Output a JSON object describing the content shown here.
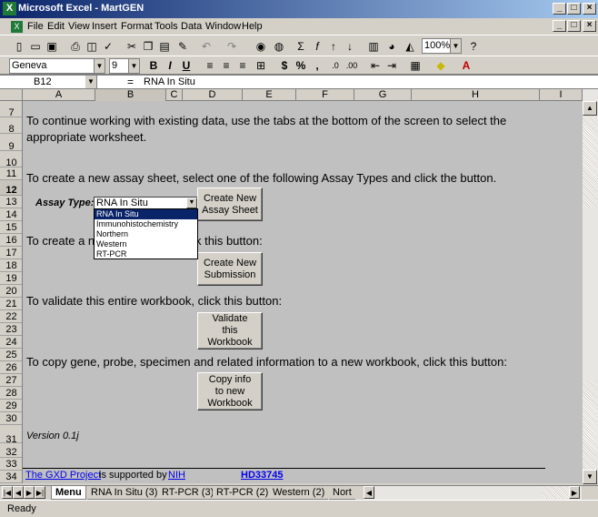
{
  "window": {
    "title": "Microsoft Excel - MartGEN"
  },
  "menu": [
    "File",
    "Edit",
    "View",
    "Insert",
    "Format",
    "Tools",
    "Data",
    "Window",
    "Help"
  ],
  "toolbar": {
    "zoom": "100%",
    "font": "Geneva",
    "size": "9"
  },
  "formula": {
    "cell": "B12",
    "equals": "=",
    "content": "RNA In Situ"
  },
  "columns": [
    "A",
    "B",
    "C",
    "D",
    "E",
    "F",
    "G",
    "H",
    "I"
  ],
  "rows": [
    "7",
    "8",
    "9",
    "10",
    "11",
    "12",
    "13",
    "14",
    "15",
    "16",
    "17",
    "18",
    "19",
    "20",
    "21",
    "22",
    "23",
    "24",
    "25",
    "26",
    "27",
    "28",
    "29",
    "30",
    "31",
    "32",
    "33",
    "34"
  ],
  "text": {
    "continue": "To continue working with existing data, use the tabs at the bottom of the screen to select the",
    "continue2": "appropriate worksheet.",
    "create": "To create a new assay sheet, select one of the following Assay Types and click the button.",
    "assay_label": "Assay Type:",
    "create_sub": "To create a n",
    "create_sub2": "k this button:",
    "validate": "To validate this entire workbook, click this button:",
    "copy": "To copy gene, probe, specimen and related  information to a new workbook, click this button:",
    "version": "Version 0.1j",
    "gxd": "The GXD Project",
    "supported": "is supported by",
    "nih": "NIH",
    "grant": "HD33745"
  },
  "buttons": {
    "new_assay": "Create New Assay Sheet",
    "new_sub": "Create New Submission",
    "validate": "Validate this Workbook",
    "copy": "Copy info to new Workbook"
  },
  "assay_select": {
    "value": "RNA In Situ",
    "options": [
      "RNA In Situ",
      "Immunohistochemistry",
      "Northern",
      "Western",
      "RT-PCR"
    ]
  },
  "tabs": [
    "Menu",
    "RNA In Situ (3)",
    "RT-PCR (3)",
    "RT-PCR (2)",
    "Western (2)",
    "Nort"
  ],
  "status": "Ready"
}
